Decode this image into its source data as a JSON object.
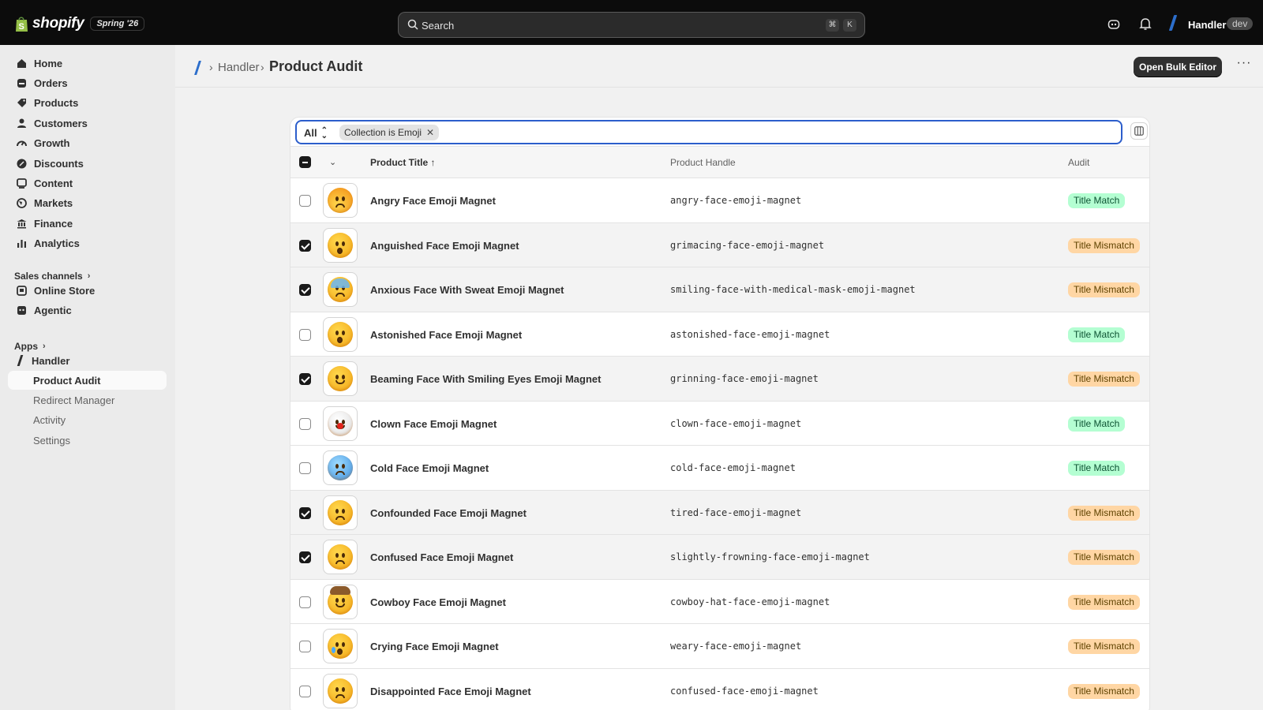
{
  "topbar": {
    "brand": "shopify",
    "edition": "Spring '26",
    "search_placeholder": "Search",
    "shortcut_keys": [
      "⌘",
      "K"
    ],
    "store_name": "Handler",
    "store_badge": "dev"
  },
  "sidebar": {
    "main_items": [
      {
        "label": "Home",
        "icon": "home-icon"
      },
      {
        "label": "Orders",
        "icon": "orders-icon"
      },
      {
        "label": "Products",
        "icon": "tag-icon"
      },
      {
        "label": "Customers",
        "icon": "person-icon"
      },
      {
        "label": "Growth",
        "icon": "gauge-icon"
      },
      {
        "label": "Discounts",
        "icon": "discount-icon"
      },
      {
        "label": "Content",
        "icon": "content-icon"
      },
      {
        "label": "Markets",
        "icon": "globe-icon"
      },
      {
        "label": "Finance",
        "icon": "bank-icon"
      },
      {
        "label": "Analytics",
        "icon": "bar-chart-icon"
      }
    ],
    "sales_channels_label": "Sales channels",
    "channels": [
      {
        "label": "Online Store",
        "icon": "store-icon"
      },
      {
        "label": "Agentic",
        "icon": "agent-icon"
      }
    ],
    "apps_label": "Apps",
    "app_name": "Handler",
    "app_subitems": [
      "Product Audit",
      "Redirect Manager",
      "Activity",
      "Settings"
    ],
    "active_subitem": "Product Audit"
  },
  "header": {
    "breadcrumb_app": "Handler",
    "title": "Product Audit",
    "bulk_button": "Open Bulk Editor",
    "more_label": "···"
  },
  "filters": {
    "view_select": "All",
    "chip_label": "Collection is Emoji"
  },
  "table": {
    "columns": {
      "title": "Product Title ↑",
      "handle": "Product Handle",
      "audit": "Audit"
    },
    "rows": [
      {
        "title": "Angry Face Emoji Magnet",
        "handle": "angry-face-emoji-magnet",
        "audit": "Title Match",
        "checked": false,
        "emoji": "angry"
      },
      {
        "title": "Anguished Face Emoji Magnet",
        "handle": "grimacing-face-emoji-magnet",
        "audit": "Title Mismatch",
        "checked": true,
        "emoji": "anguished"
      },
      {
        "title": "Anxious Face With Sweat Emoji Magnet",
        "handle": "smiling-face-with-medical-mask-emoji-magnet",
        "audit": "Title Mismatch",
        "checked": true,
        "emoji": "anxious"
      },
      {
        "title": "Astonished Face Emoji Magnet",
        "handle": "astonished-face-emoji-magnet",
        "audit": "Title Match",
        "checked": false,
        "emoji": "astonished"
      },
      {
        "title": "Beaming Face With Smiling Eyes Emoji Magnet",
        "handle": "grinning-face-emoji-magnet",
        "audit": "Title Mismatch",
        "checked": true,
        "emoji": "beaming"
      },
      {
        "title": "Clown Face Emoji Magnet",
        "handle": "clown-face-emoji-magnet",
        "audit": "Title Match",
        "checked": false,
        "emoji": "clown"
      },
      {
        "title": "Cold Face Emoji Magnet",
        "handle": "cold-face-emoji-magnet",
        "audit": "Title Match",
        "checked": false,
        "emoji": "cold"
      },
      {
        "title": "Confounded Face Emoji Magnet",
        "handle": "tired-face-emoji-magnet",
        "audit": "Title Mismatch",
        "checked": true,
        "emoji": "confounded"
      },
      {
        "title": "Confused Face Emoji Magnet",
        "handle": "slightly-frowning-face-emoji-magnet",
        "audit": "Title Mismatch",
        "checked": true,
        "emoji": "confused"
      },
      {
        "title": "Cowboy Face Emoji Magnet",
        "handle": "cowboy-hat-face-emoji-magnet",
        "audit": "Title Mismatch",
        "checked": false,
        "emoji": "cowboy"
      },
      {
        "title": "Crying Face Emoji Magnet",
        "handle": "weary-face-emoji-magnet",
        "audit": "Title Mismatch",
        "checked": false,
        "emoji": "crying"
      },
      {
        "title": "Disappointed Face Emoji Magnet",
        "handle": "confused-face-emoji-magnet",
        "audit": "Title Mismatch",
        "checked": false,
        "emoji": "disappointed"
      }
    ]
  },
  "colors": {
    "topbar": "#0c0c0c",
    "accent": "#2c6ecb",
    "match_bg": "#b4fed2",
    "mismatch_bg": "#ffd6a4"
  }
}
